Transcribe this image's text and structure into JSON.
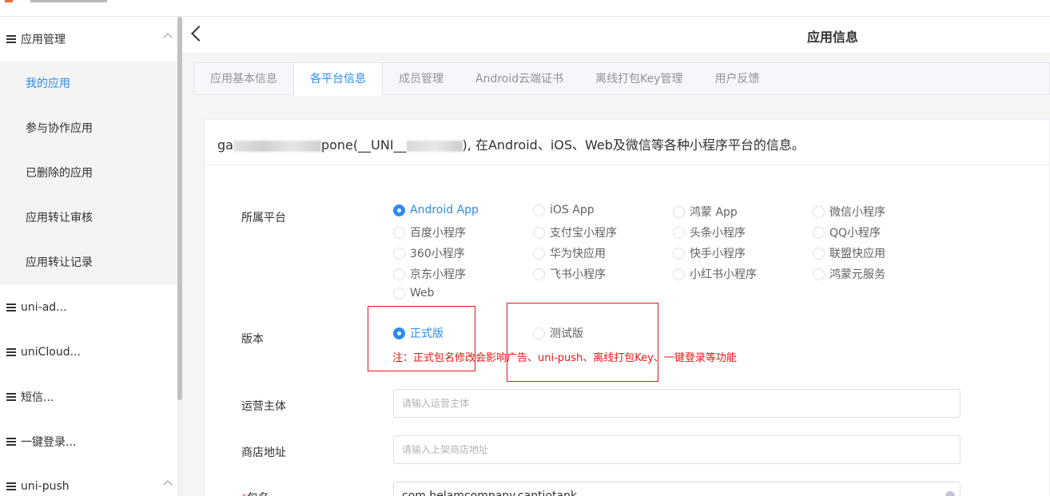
{
  "sidebar": {
    "groups": [
      {
        "label": "应用管理",
        "expanded": true
      },
      {
        "label": "uni-ad..."
      },
      {
        "label": "uniCloud..."
      },
      {
        "label": "短信..."
      },
      {
        "label": "一键登录..."
      },
      {
        "label": "uni-push",
        "expanded": true
      }
    ],
    "sub_items": [
      {
        "label": "我的应用",
        "active": true
      },
      {
        "label": "参与协作应用"
      },
      {
        "label": "已删除的应用"
      },
      {
        "label": "应用转让审核"
      },
      {
        "label": "应用转让记录"
      }
    ]
  },
  "header": {
    "title": "应用信息"
  },
  "tabs": [
    {
      "label": "应用基本信息"
    },
    {
      "label": "各平台信息",
      "active": true
    },
    {
      "label": "成员管理"
    },
    {
      "label": "Android云端证书"
    },
    {
      "label": "离线打包Key管理"
    },
    {
      "label": "用户反馈"
    }
  ],
  "card": {
    "desc_prefix": "ga",
    "desc_mid": "pone(__UNI__",
    "desc_suffix": "), 在Android、iOS、Web及微信等各种小程序平台的信息。"
  },
  "form": {
    "platform_label": "所属平台",
    "platforms": [
      "Android App",
      "iOS App",
      "鸿蒙 App",
      "微信小程序",
      "百度小程序",
      "支付宝小程序",
      "头条小程序",
      "QQ小程序",
      "360小程序",
      "华为快应用",
      "快手小程序",
      "联盟快应用",
      "京东小程序",
      "飞书小程序",
      "小红书小程序",
      "鸿蒙元服务",
      "Web"
    ],
    "platform_selected": "Android App",
    "version_label": "版本",
    "version_options": [
      "正式版",
      "测试版"
    ],
    "version_selected": "正式版",
    "version_note": "注：正式包名修改会影响广告、uni-push、离线打包Key、一键登录等功能",
    "operator_label": "运营主体",
    "operator_placeholder": "请输入运营主体",
    "store_label": "商店地址",
    "store_placeholder": "请输入上架商店地址",
    "package_required_mark": "*",
    "package_label": "包名",
    "package_value": "com.helamcompany.cantiotank"
  },
  "colors": {
    "accent": "#2d8cf0",
    "note_red": "#f01414",
    "annotation_red": "#e8141c"
  },
  "icons": [
    "list-icon",
    "chevron-up-icon",
    "back-arrow-icon",
    "radio-icon",
    "clear-icon"
  ]
}
